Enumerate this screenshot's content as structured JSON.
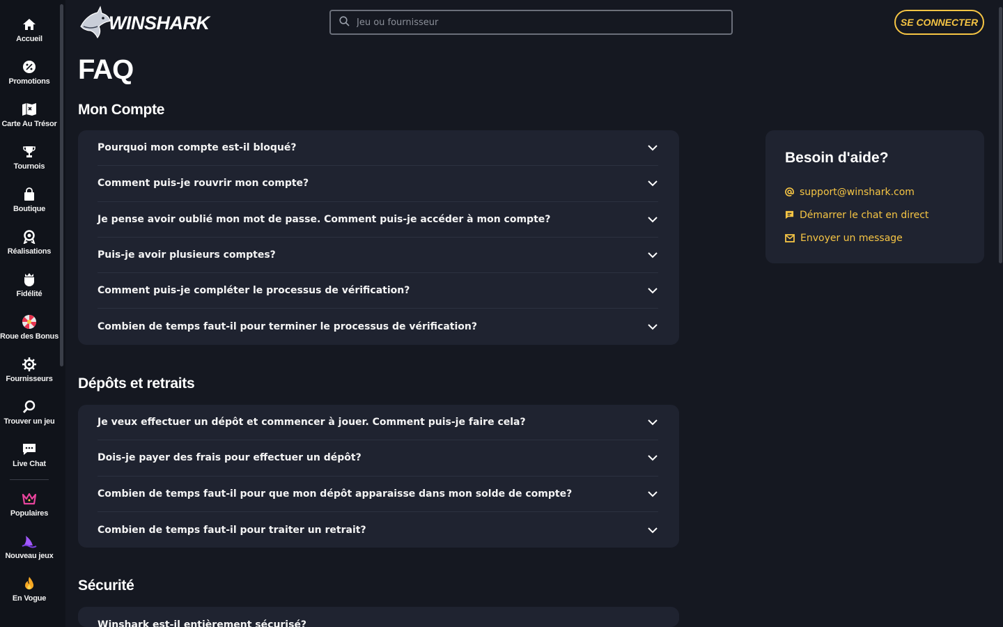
{
  "brand": {
    "name": "WINSHARK"
  },
  "colors": {
    "accent": "#f6c544",
    "background": "#151821",
    "sidebar": "#10131a",
    "card": "#1f2330"
  },
  "sidebar": {
    "items": [
      {
        "label": "Accueil",
        "icon": "home-icon"
      },
      {
        "label": "Promotions",
        "icon": "percent-icon"
      },
      {
        "label": "Carte Au Trésor",
        "icon": "map-icon"
      },
      {
        "label": "Tournois",
        "icon": "trophy-icon"
      },
      {
        "label": "Boutique",
        "icon": "bag-icon"
      },
      {
        "label": "Réalisations",
        "icon": "medal-icon"
      },
      {
        "label": "Fidélité",
        "icon": "crown-shield-icon"
      },
      {
        "label": "Roue des Bonus",
        "icon": "wheel-icon"
      },
      {
        "label": "Fournisseurs",
        "icon": "gear-icon"
      },
      {
        "label": "Trouver un jeu",
        "icon": "search-icon"
      },
      {
        "label": "Live Chat",
        "icon": "chat-icon"
      },
      {
        "label": "Populaires",
        "icon": "crown-icon"
      },
      {
        "label": "Nouveau jeux",
        "icon": "shark-fin-icon"
      },
      {
        "label": "En Vogue",
        "icon": "flame-icon"
      }
    ]
  },
  "header": {
    "search_placeholder": "Jeu ou fournisseur",
    "login_label": "SE CONNECTER"
  },
  "page": {
    "title": "FAQ",
    "sections": [
      {
        "title": "Mon Compte",
        "questions": [
          "Pourquoi mon compte est-il bloqué?",
          "Comment puis-je rouvrir mon compte?",
          "Je pense avoir oublié mon mot de passe. Comment puis-je accéder à mon compte?",
          "Puis-je avoir plusieurs comptes?",
          "Comment puis-je compléter le processus de vérification?",
          "Combien de temps faut-il pour terminer le processus de vérification?"
        ]
      },
      {
        "title": "Dépôts et retraits",
        "questions": [
          "Je veux effectuer un dépôt et commencer à jouer. Comment puis-je faire cela?",
          "Dois-je payer des frais pour effectuer un dépôt?",
          "Combien de temps faut-il pour que mon dépôt apparaisse dans mon solde de compte?",
          "Combien de temps faut-il pour traiter un retrait?"
        ]
      },
      {
        "title": "Sécurité",
        "questions": [
          "Winshark est-il entièrement sécurisé?"
        ]
      }
    ]
  },
  "help": {
    "title": "Besoin d'aide?",
    "email": "support@winshark.com",
    "chat": "Démarrer le chat en direct",
    "message": "Envoyer un message"
  }
}
